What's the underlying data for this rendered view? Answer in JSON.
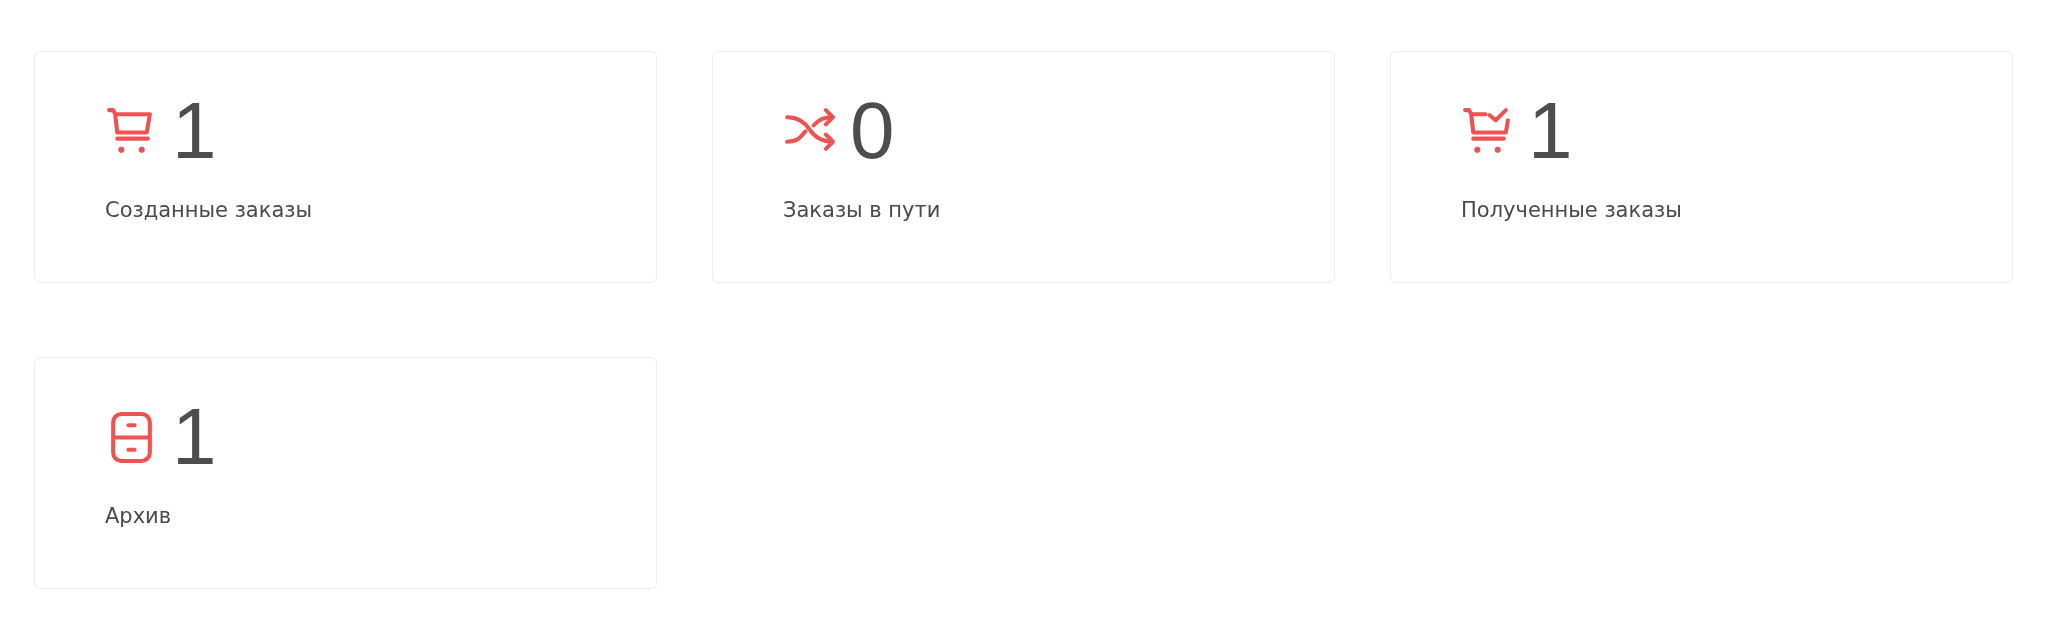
{
  "cards": [
    {
      "kind": "cart",
      "count": "1",
      "label": "Созданные заказы"
    },
    {
      "kind": "shuffle",
      "count": "0",
      "label": "Заказы в пути"
    },
    {
      "kind": "cart-check",
      "count": "1",
      "label": "Полученные заказы"
    },
    {
      "kind": "cabinet",
      "count": "1",
      "label": "Архив"
    }
  ]
}
